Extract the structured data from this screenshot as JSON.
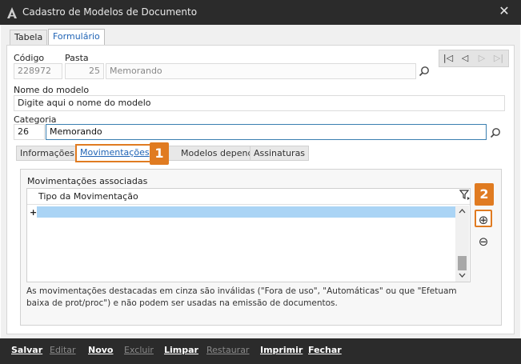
{
  "window": {
    "title": "Cadastro de Modelos de Documento",
    "close_glyph": "✕"
  },
  "tabs": [
    {
      "label": "Tabela"
    },
    {
      "label": "Formulário"
    }
  ],
  "navigation": {
    "first": "|◁",
    "prev": "◁",
    "next": "▷",
    "last": "▷|"
  },
  "fields": {
    "codigo_label": "Código",
    "codigo_value": "228972",
    "pasta_label": "Pasta",
    "pasta_code": "25",
    "pasta_name": "Memorando",
    "nome_label": "Nome do modelo",
    "nome_value": "Digite aqui o nome do modelo",
    "categoria_label": "Categoria",
    "categoria_code": "26",
    "categoria_name": "Memorando"
  },
  "subtabs": [
    {
      "label": "Informações"
    },
    {
      "label": "Movimentações"
    },
    {
      "label": "Modelos dependentes"
    },
    {
      "label": "Assinaturas"
    }
  ],
  "callouts": {
    "one": "1",
    "two": "2"
  },
  "movimentacoes": {
    "section_label": "Movimentações associadas",
    "column_header": "Tipo da Movimentação",
    "new_row_marker": "+",
    "add_glyph": "⊕",
    "remove_glyph": "⊖",
    "note": "As movimentações destacadas em cinza são inválidas (\"Fora de uso\", \"Automáticas\" ou que \"Efetuam baixa de prot/proc\") e não podem ser usadas na emissão de documentos."
  },
  "toolbar": {
    "salvar": "Salvar",
    "editar": "Editar",
    "novo": "Novo",
    "excluir": "Excluir",
    "limpar": "Limpar",
    "restaurar": "Restaurar",
    "imprimir": "Imprimir",
    "fechar": "Fechar"
  },
  "colors": {
    "accent": "#1f63b5",
    "callout": "#e07b21",
    "selection": "#aad4f5",
    "chrome": "#2b2b2b"
  }
}
